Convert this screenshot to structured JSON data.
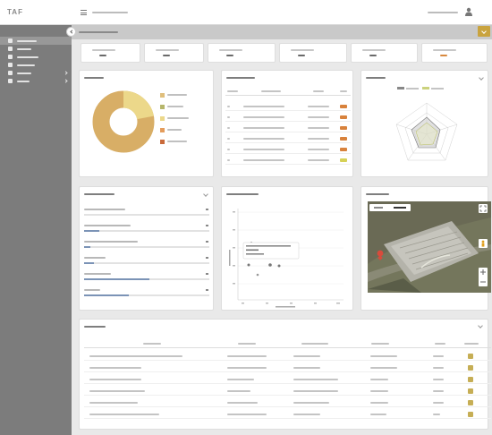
{
  "brand": {
    "logo": "TAF"
  },
  "header": {
    "user_icon": "person-icon"
  },
  "sidebar": {
    "items": [
      {
        "icon": "dashboard-icon",
        "active": true
      },
      {
        "icon": "projects-icon",
        "active": false
      },
      {
        "icon": "components-icon",
        "active": false
      },
      {
        "icon": "reports-icon",
        "active": false
      },
      {
        "icon": "settings-icon",
        "active": false
      },
      {
        "icon": "admin-icon",
        "active": false
      }
    ]
  },
  "kpis": [
    {
      "value_color": "#6a6a6a"
    },
    {
      "value_color": "#6a6a6a"
    },
    {
      "value_color": "#6a6a6a"
    },
    {
      "value_color": "#6a6a6a"
    },
    {
      "value_color": "#6a6a6a"
    },
    {
      "value_color": "#d8893f"
    }
  ],
  "risk_donut": {
    "segments": [
      {
        "fraction": 0.22,
        "color": "#ecd88a"
      },
      {
        "fraction": 0.78,
        "color": "#d8ae66"
      }
    ],
    "legend_colors": [
      "#e0bf7c",
      "#b6b66b",
      "#ecd88a",
      "#e49c5c",
      "#c96a3a"
    ]
  },
  "risk_table": {
    "badges": [
      "#d8823c",
      "#d8823c",
      "#d8823c",
      "#d8823c",
      "#d8823c",
      "#d6d157"
    ]
  },
  "progress": [
    {
      "pct": 0
    },
    {
      "pct": 12
    },
    {
      "pct": 5
    },
    {
      "pct": 8
    },
    {
      "pct": 52
    },
    {
      "pct": 36
    }
  ],
  "map": {
    "buttons": [
      "expand-icon",
      "person-icon",
      "zoom-in-icon",
      "zoom-out-icon"
    ]
  },
  "colors": {
    "accent": "#c9a33e",
    "sidebar": "#7c7c7c",
    "progress": "#7b93b6",
    "status_ok": "#c6ae55"
  }
}
